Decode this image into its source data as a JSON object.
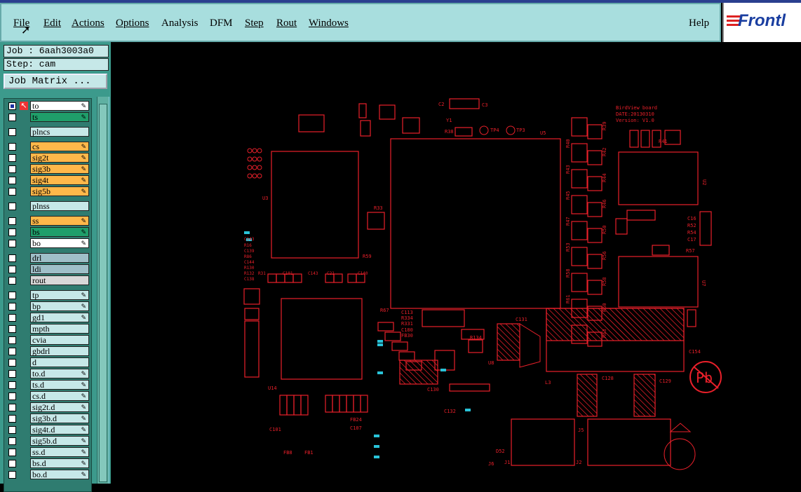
{
  "menu": {
    "items": [
      {
        "label": "File",
        "underline": true
      },
      {
        "label": "Edit",
        "underline": true
      },
      {
        "label": "Actions",
        "underline": true
      },
      {
        "label": "Options",
        "underline": true
      },
      {
        "label": "Analysis",
        "underline": false
      },
      {
        "label": "DFM",
        "underline": false
      },
      {
        "label": "Step",
        "underline": true
      },
      {
        "label": "Rout",
        "underline": true
      },
      {
        "label": "Windows",
        "underline": true
      }
    ],
    "help": "Help"
  },
  "logo_text": "Frontl",
  "job": {
    "job_line": "Job : 6aah3003a0",
    "step_line": "Step: cam",
    "matrix_button": "Job Matrix ..."
  },
  "layers": [
    {
      "name": "to",
      "color": "#ffffff",
      "checked": true,
      "pen": true,
      "active": true
    },
    {
      "name": "ts",
      "color": "#1f9e6a",
      "checked": false,
      "pen": true
    },
    {
      "name": "plncs",
      "color": "#c6e8e8",
      "checked": false,
      "pen": false,
      "gap": true
    },
    {
      "name": "cs",
      "color": "#ffb84a",
      "checked": false,
      "pen": true,
      "gap": true
    },
    {
      "name": "sig2t",
      "color": "#ffb84a",
      "checked": false,
      "pen": true
    },
    {
      "name": "sig3b",
      "color": "#ffb84a",
      "checked": false,
      "pen": true
    },
    {
      "name": "sig4t",
      "color": "#ffb84a",
      "checked": false,
      "pen": true
    },
    {
      "name": "sig5b",
      "color": "#ffb84a",
      "checked": false,
      "pen": true
    },
    {
      "name": "plnss",
      "color": "#c6e8e8",
      "checked": false,
      "pen": false,
      "gap": true
    },
    {
      "name": "ss",
      "color": "#ffb84a",
      "checked": false,
      "pen": true,
      "gap": true
    },
    {
      "name": "bs",
      "color": "#1f9e6a",
      "checked": false,
      "pen": true
    },
    {
      "name": "bo",
      "color": "#ffffff",
      "checked": false,
      "pen": true
    },
    {
      "name": "drl",
      "color": "#9fbfc8",
      "checked": false,
      "pen": false,
      "gap": true
    },
    {
      "name": "ldi",
      "color": "#9fbfc8",
      "checked": false,
      "pen": false
    },
    {
      "name": "rout",
      "color": "#d8d8d8",
      "checked": false,
      "pen": false
    },
    {
      "name": "tp",
      "color": "#c6e8e8",
      "checked": false,
      "pen": true,
      "gap": true
    },
    {
      "name": "bp",
      "color": "#c6e8e8",
      "checked": false,
      "pen": true
    },
    {
      "name": "gd1",
      "color": "#c6e8e8",
      "checked": false,
      "pen": true
    },
    {
      "name": "mpth",
      "color": "#c6e8e8",
      "checked": false,
      "pen": false
    },
    {
      "name": "cvia",
      "color": "#c6e8e8",
      "checked": false,
      "pen": false
    },
    {
      "name": "gbdrl",
      "color": "#c6e8e8",
      "checked": false,
      "pen": false
    },
    {
      "name": "d",
      "color": "#c6e8e8",
      "checked": false,
      "pen": false
    },
    {
      "name": "to.d",
      "color": "#c6e8e8",
      "checked": false,
      "pen": true
    },
    {
      "name": "ts.d",
      "color": "#c6e8e8",
      "checked": false,
      "pen": true
    },
    {
      "name": "cs.d",
      "color": "#c6e8e8",
      "checked": false,
      "pen": true
    },
    {
      "name": "sig2t.d",
      "color": "#c6e8e8",
      "checked": false,
      "pen": true
    },
    {
      "name": "sig3b.d",
      "color": "#c6e8e8",
      "checked": false,
      "pen": true
    },
    {
      "name": "sig4t.d",
      "color": "#c6e8e8",
      "checked": false,
      "pen": true
    },
    {
      "name": "sig5b.d",
      "color": "#c6e8e8",
      "checked": false,
      "pen": true
    },
    {
      "name": "ss.d",
      "color": "#c6e8e8",
      "checked": false,
      "pen": true
    },
    {
      "name": "bs.d",
      "color": "#c6e8e8",
      "checked": false,
      "pen": true
    },
    {
      "name": "bo.d",
      "color": "#c6e8e8",
      "checked": false,
      "pen": true
    }
  ],
  "board": {
    "title_lines": [
      "BirdView board",
      "DATE:20130310",
      "Version: V1.0"
    ],
    "trace_color": "#e8202a",
    "accent_color": "#29c3d8",
    "labels": [
      "U3",
      "U5",
      "U2",
      "U7",
      "U8",
      "U14",
      "Y1",
      "TP4",
      "TP3",
      "C131",
      "C154",
      "C128",
      "C129",
      "L3",
      "J5",
      "J2",
      "J1",
      "J6",
      "D52",
      "FB24",
      "C107",
      "C101",
      "FB8",
      "FB1",
      "C132",
      "C130",
      "R134",
      "C113",
      "R334",
      "R331",
      "C180",
      "FB30",
      "R62",
      "R59",
      "R33",
      "C8",
      "C5",
      "C3",
      "R39",
      "R40",
      "R42",
      "R43",
      "R44",
      "R45",
      "R46",
      "R47",
      "R50",
      "R51",
      "R53",
      "R56",
      "R57",
      "R58",
      "R60",
      "R61",
      "R63",
      "C16",
      "R52",
      "R54",
      "C17",
      "C19",
      "C18",
      "C14",
      "C15",
      "FB4",
      "R41",
      "C11",
      "C10",
      "C9",
      "C2",
      "C1",
      "R38",
      "C103",
      "D5",
      "D4",
      "C186",
      "R67",
      "R83",
      "R71",
      "R72",
      "R78",
      "C33",
      "R36",
      "C144",
      "R130",
      "R132",
      "C138",
      "C143",
      "C139",
      "C141",
      "C101",
      "C140",
      "C109",
      "C131"
    ]
  }
}
